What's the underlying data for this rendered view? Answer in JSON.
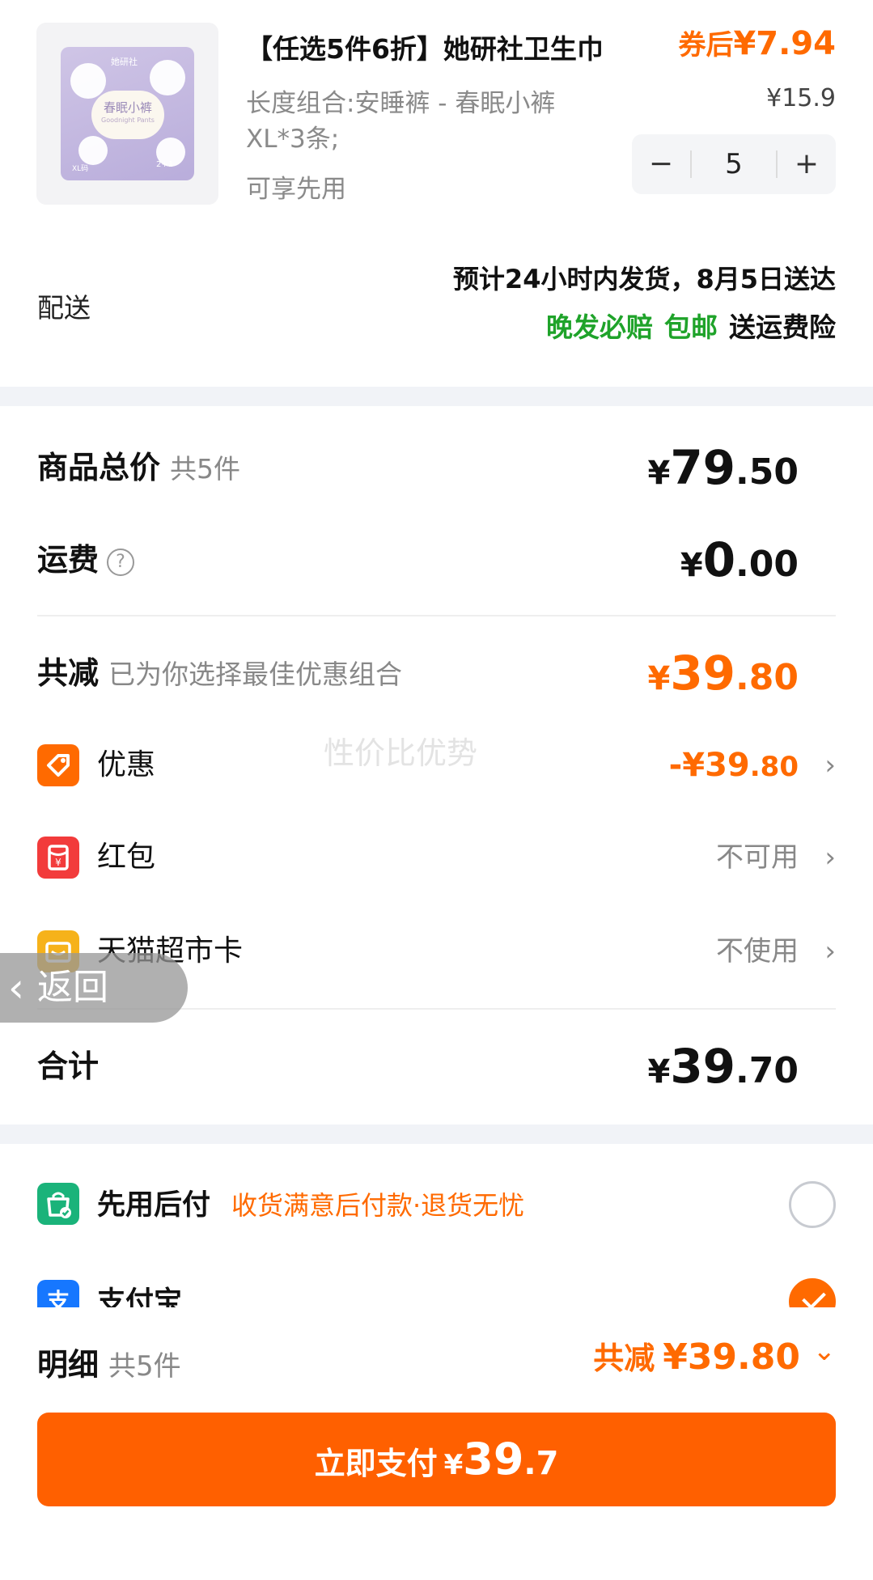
{
  "product": {
    "title": "【任选5件6折】她研社卫生巾",
    "price_label": "券后",
    "price": "¥7.94",
    "spec_line1": "长度组合:安睡裤 - 春眠小裤",
    "spec_line2": "XL*3条;",
    "original_price": "¥15.9",
    "perk": "可享先用",
    "image": {
      "brand": "她研社",
      "name": "春眠小裤",
      "subtitle": "Goodnight Pants",
      "size": "XL码",
      "count": "2+1"
    },
    "quantity": {
      "minus": "−",
      "value": "5",
      "plus": "+"
    }
  },
  "shipping": {
    "label": "配送",
    "estimate": "预计24小时内发货，8月5日送达",
    "tags": [
      "晚发必赔",
      "包邮"
    ],
    "insurance": "送运费险"
  },
  "summary": {
    "goods_total": {
      "label": "商品总价",
      "count": "共5件",
      "currency": "¥",
      "int": "79",
      "dec": ".50"
    },
    "freight": {
      "label": "运费",
      "help_icon": "?",
      "currency": "¥",
      "int": "0",
      "dec": ".00"
    },
    "discount": {
      "label": "共减",
      "note": "已为你选择最佳优惠组合",
      "currency": "¥",
      "int": "39",
      "dec": ".80"
    },
    "options": [
      {
        "icon": "tag-icon",
        "label": "优惠",
        "value_main": "-¥39",
        "value_dec": ".80",
        "color": "#ff6a00"
      },
      {
        "icon": "red-packet-icon",
        "label": "红包",
        "value": "不可用",
        "color": "#f23b3b"
      },
      {
        "icon": "tmall-card-icon",
        "label": "天猫超市卡",
        "value": "不使用",
        "color": "#f6b21a"
      }
    ],
    "total": {
      "label": "合计",
      "currency": "¥",
      "int": "39",
      "dec": ".70"
    },
    "chevron": "›"
  },
  "watermark": "性价比优势",
  "back": {
    "arrow": "‹",
    "label": "返回"
  },
  "payment": [
    {
      "icon": "shopping-bag-icon",
      "label": "先用后付",
      "tip": "收货满意后付款·退货无忧",
      "selected": false,
      "color": "#1ab37a"
    },
    {
      "icon": "alipay-icon",
      "label": "支付宝",
      "selected": true,
      "color": "#1677ff"
    }
  ],
  "footer": {
    "label": "明细",
    "count": "共5件",
    "discount_label": "共减",
    "discount_value": "¥39.80",
    "chevron": "⌄",
    "pay_label": "立即支付",
    "pay_currency": "¥",
    "pay_int": "39",
    "pay_dec": ".7"
  }
}
